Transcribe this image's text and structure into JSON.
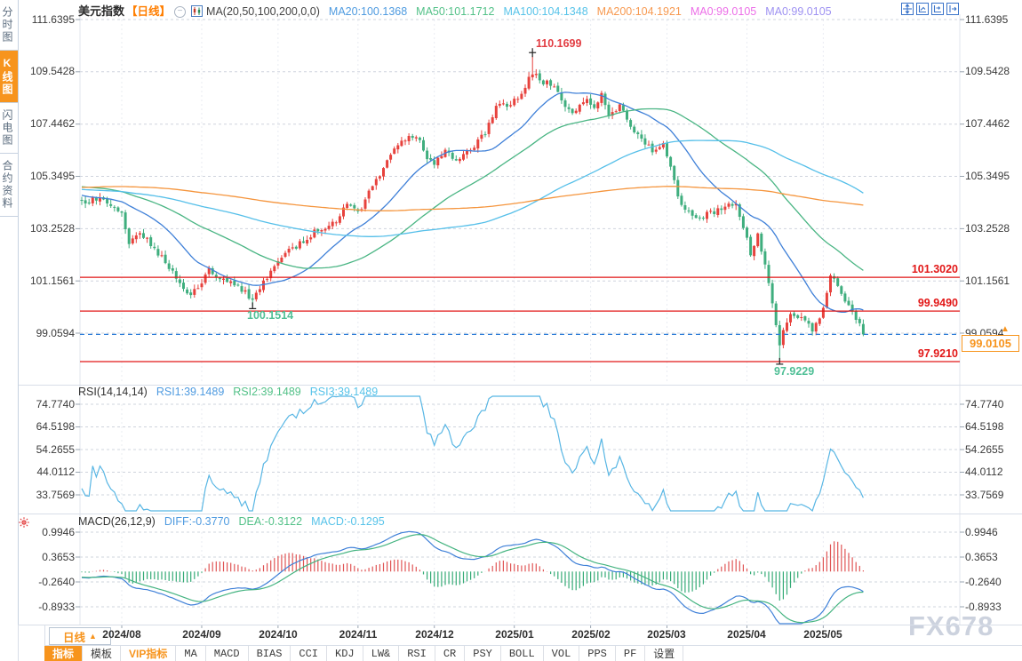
{
  "header": {
    "symbol": "美元指数",
    "period": "【日线】",
    "indicator": "MA(20,50,100,200,0,0)",
    "ma_values": [
      {
        "text": "MA20:100.1368",
        "color": "#4f9be0"
      },
      {
        "text": "MA50:101.1712",
        "color": "#53c188"
      },
      {
        "text": "MA100:104.1348",
        "color": "#57c3e9"
      },
      {
        "text": "MA200:104.1921",
        "color": "#f79a52"
      },
      {
        "text": "MA0:99.0105",
        "color": "#ec6fe8"
      },
      {
        "text": "MA0:99.0105",
        "color": "#9e92f2"
      }
    ],
    "toolbar_icons": [
      "pan-crosshair-icon",
      "scale-y-axis-icon",
      "scale-x-axis-icon",
      "shift-right-icon"
    ]
  },
  "sidebar": {
    "items": [
      {
        "label": "分时图",
        "active": false
      },
      {
        "label": "K线图",
        "active": true
      },
      {
        "label": "闪电图",
        "active": false
      },
      {
        "label": "合约资料",
        "active": false
      }
    ]
  },
  "rsi_panel": {
    "title": "RSI(14,14,14)",
    "values": [
      {
        "text": "RSI1:39.1489",
        "color": "#4f9be0"
      },
      {
        "text": "RSI2:39.1489",
        "color": "#53c188"
      },
      {
        "text": "RSI3:39.1489",
        "color": "#57c3e9"
      }
    ],
    "axis_labels": [
      "74.7740",
      "64.5198",
      "54.2655",
      "44.0112",
      "33.7569"
    ]
  },
  "macd_panel": {
    "title": "MACD(26,12,9)",
    "values": [
      {
        "text": "DIFF:-0.3770",
        "color": "#4f9be0"
      },
      {
        "text": "DEA:-0.3122",
        "color": "#53c188"
      },
      {
        "text": "MACD:-0.1295",
        "color": "#57c3e9"
      }
    ],
    "axis_labels": [
      "0.9946",
      "0.3653",
      "-0.2640",
      "-0.8933"
    ]
  },
  "bottom": {
    "period_label": "日线",
    "period_arrow": "▲",
    "tabs": [
      {
        "label": "指标",
        "variant": "active"
      },
      {
        "label": "模板",
        "variant": "cn"
      },
      {
        "label": "VIP指标",
        "variant": "vip"
      },
      {
        "label": "MA",
        "variant": "en"
      },
      {
        "label": "MACD",
        "variant": "en"
      },
      {
        "label": "BIAS",
        "variant": "en"
      },
      {
        "label": "CCI",
        "variant": "en"
      },
      {
        "label": "KDJ",
        "variant": "en"
      },
      {
        "label": "LW&",
        "variant": "en"
      },
      {
        "label": "RSI",
        "variant": "en"
      },
      {
        "label": "CR",
        "variant": "en"
      },
      {
        "label": "PSY",
        "variant": "en"
      },
      {
        "label": "BOLL",
        "variant": "en"
      },
      {
        "label": "VOL",
        "variant": "en"
      },
      {
        "label": "PPS",
        "variant": "en"
      },
      {
        "label": "PF",
        "variant": "en"
      },
      {
        "label": "设置",
        "variant": "cn"
      }
    ]
  },
  "watermark": "FX678",
  "chart_data": {
    "type": "candlestick",
    "title": "美元指数 日线 (US Dollar Index, daily) with MA/RSI/MACD",
    "price_axis_labels": [
      "111.6395",
      "109.5428",
      "107.4462",
      "105.3495",
      "103.2528",
      "101.1561",
      "99.0594"
    ],
    "price_axis_values": [
      111.6395,
      109.5428,
      107.4462,
      105.3495,
      103.2528,
      101.1561,
      99.0594
    ],
    "rsi_axis_values": [
      74.774,
      64.5198,
      54.2655,
      44.0112,
      33.7569
    ],
    "macd_axis_values": [
      0.9946,
      0.3653,
      -0.264,
      -0.8933
    ],
    "month_ticks": [
      {
        "label": "2024/08",
        "day": 11
      },
      {
        "label": "2024/09",
        "day": 33
      },
      {
        "label": "2024/10",
        "day": 54
      },
      {
        "label": "2024/11",
        "day": 76
      },
      {
        "label": "2024/12",
        "day": 97
      },
      {
        "label": "2025/01",
        "day": 119
      },
      {
        "label": "2025/02",
        "day": 140
      },
      {
        "label": "2025/03",
        "day": 161
      },
      {
        "label": "2025/04",
        "day": 183
      },
      {
        "label": "2025/05",
        "day": 204
      }
    ],
    "levels": [
      {
        "label": "101.3020",
        "value": 101.302
      },
      {
        "label": "99.9490",
        "value": 99.949
      },
      {
        "label": "97.9210",
        "value": 97.921
      }
    ],
    "last_price": {
      "label": "99.0105",
      "value": 99.0105
    },
    "annotations": [
      {
        "text": "110.1699",
        "kind": "high",
        "day": 124,
        "value": 110.1699,
        "color": "#e23c42"
      },
      {
        "text": "100.1514",
        "kind": "low",
        "day": 47,
        "value": 100.1514,
        "color": "#4fbf96"
      },
      {
        "text": "97.9229",
        "kind": "low",
        "day": 192,
        "value": 97.9229,
        "color": "#4fbf96"
      }
    ],
    "moving_averages": [
      {
        "period": 20,
        "current": 100.1368,
        "color": "#3f80d8"
      },
      {
        "period": 50,
        "current": 101.1712,
        "color": "#49b583"
      },
      {
        "period": 100,
        "current": 104.1348,
        "color": "#55bfe9"
      },
      {
        "period": 200,
        "current": 104.1921,
        "color": "#f5953d"
      }
    ],
    "rsi_current": [
      39.1489,
      39.1489,
      39.1489
    ],
    "macd_current": {
      "diff": -0.377,
      "dea": -0.3122,
      "macd": -0.1295
    },
    "candle_colors": {
      "up": "#e7423d",
      "down": "#3fae7e"
    },
    "price_anchors": [
      [
        0,
        104.25
      ],
      [
        4,
        104.45
      ],
      [
        8,
        104.15
      ],
      [
        11,
        104.0
      ],
      [
        13,
        102.55
      ],
      [
        16,
        103.15
      ],
      [
        20,
        102.5
      ],
      [
        25,
        101.45
      ],
      [
        30,
        100.6
      ],
      [
        33,
        101.05
      ],
      [
        35,
        101.65
      ],
      [
        39,
        101.2
      ],
      [
        44,
        100.8
      ],
      [
        46,
        100.55
      ],
      [
        47,
        100.4
      ],
      [
        49,
        100.85
      ],
      [
        52,
        101.5
      ],
      [
        55,
        102.1
      ],
      [
        59,
        102.55
      ],
      [
        63,
        103.0
      ],
      [
        67,
        103.35
      ],
      [
        70,
        103.55
      ],
      [
        73,
        104.3
      ],
      [
        76,
        103.9
      ],
      [
        80,
        104.9
      ],
      [
        84,
        106.0
      ],
      [
        88,
        106.75
      ],
      [
        92,
        107.0
      ],
      [
        95,
        106.15
      ],
      [
        97,
        105.9
      ],
      [
        100,
        106.35
      ],
      [
        103,
        105.95
      ],
      [
        107,
        106.45
      ],
      [
        111,
        107.05
      ],
      [
        114,
        108.15
      ],
      [
        118,
        108.25
      ],
      [
        121,
        108.55
      ],
      [
        124,
        109.55
      ],
      [
        127,
        109.15
      ],
      [
        130,
        108.9
      ],
      [
        133,
        108.15
      ],
      [
        136,
        107.95
      ],
      [
        139,
        108.45
      ],
      [
        141,
        108.05
      ],
      [
        143,
        108.65
      ],
      [
        145,
        107.7
      ],
      [
        148,
        108.25
      ],
      [
        151,
        107.35
      ],
      [
        154,
        106.85
      ],
      [
        157,
        106.4
      ],
      [
        160,
        106.75
      ],
      [
        162,
        105.75
      ],
      [
        165,
        104.1
      ],
      [
        169,
        103.65
      ],
      [
        173,
        103.9
      ],
      [
        177,
        104.1
      ],
      [
        180,
        104.35
      ],
      [
        184,
        102.3
      ],
      [
        186,
        103.0
      ],
      [
        189,
        101.1
      ],
      [
        190,
        100.3
      ],
      [
        192,
        98.7
      ],
      [
        194,
        99.6
      ],
      [
        196,
        99.85
      ],
      [
        199,
        99.45
      ],
      [
        201,
        99.2
      ],
      [
        203,
        99.7
      ],
      [
        205,
        100.7
      ],
      [
        206,
        101.45
      ],
      [
        208,
        100.85
      ],
      [
        210,
        100.25
      ],
      [
        212,
        99.95
      ],
      [
        213,
        99.6
      ],
      [
        214,
        99.35
      ],
      [
        215,
        99.05
      ]
    ],
    "prehistory_anchors": [
      [
        -200,
        103.4
      ],
      [
        -180,
        104.0
      ],
      [
        -160,
        104.9
      ],
      [
        -140,
        105.7
      ],
      [
        -120,
        106.0
      ],
      [
        -100,
        105.2
      ],
      [
        -80,
        104.6
      ],
      [
        -60,
        104.5
      ],
      [
        -40,
        105.4
      ],
      [
        -25,
        105.1
      ],
      [
        -10,
        104.6
      ],
      [
        -1,
        104.3
      ]
    ],
    "forced_points": {
      "47": {
        "low": 100.1514
      },
      "124": {
        "high": 110.1699
      },
      "192": {
        "low": 97.9229
      },
      "215": {
        "close": 99.0105
      }
    }
  }
}
